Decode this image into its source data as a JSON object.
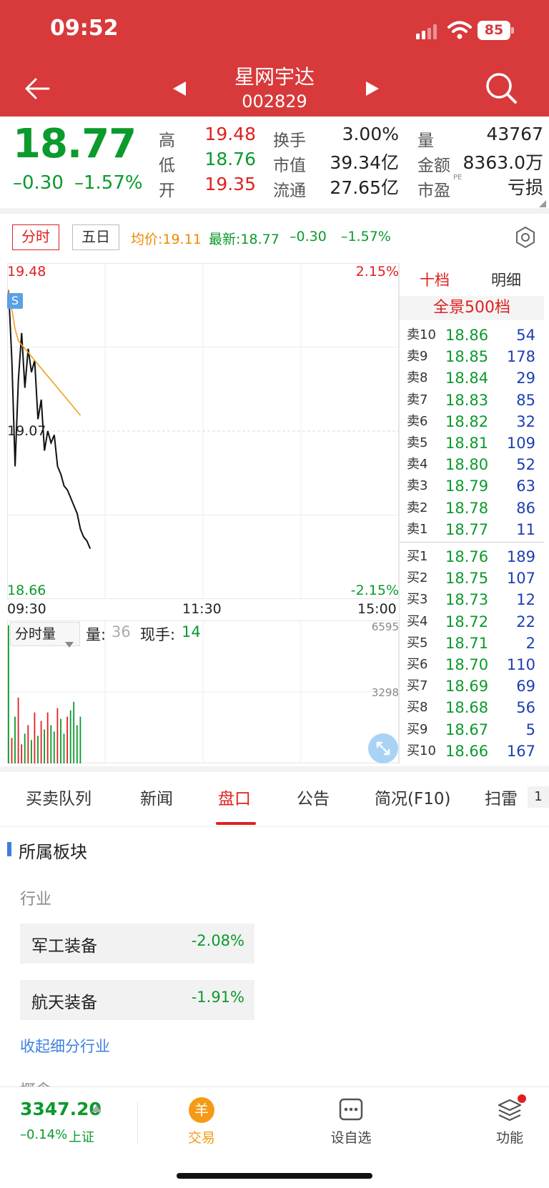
{
  "status_bar": {
    "time": "09:52",
    "battery": "85"
  },
  "header": {
    "name": "星网宇达",
    "code": "002829"
  },
  "quote": {
    "price": "18.77",
    "change": "–0.30",
    "change_pct": "–1.57%",
    "cells": [
      {
        "label": "高",
        "value": "19.48",
        "value_color": "red"
      },
      {
        "label": "换手",
        "value": "3.00%",
        "value_color": "dark"
      },
      {
        "label": "量",
        "value": "43767",
        "value_color": "dark"
      },
      {
        "label": "低",
        "value": "18.76",
        "value_color": "green"
      },
      {
        "label": "市值",
        "value": "39.34亿",
        "value_color": "dark"
      },
      {
        "label": "金额",
        "value": "8363.0万",
        "value_color": "dark"
      },
      {
        "label": "开",
        "value": "19.35",
        "value_color": "red"
      },
      {
        "label": "流通",
        "value": "27.65亿",
        "value_color": "dark"
      },
      {
        "label": "市盈",
        "value": "亏损",
        "value_color": "dark",
        "sup": "PE"
      }
    ]
  },
  "chart_tabs": {
    "intraday": "分时",
    "five_day": "五日",
    "avg_label": "均价:19.11",
    "latest_label": "最新:18.77",
    "latest_change": "–0.30",
    "latest_pct": "–1.57%"
  },
  "chart_data": {
    "type": "line",
    "ylim": [
      18.66,
      19.48
    ],
    "y_labels": {
      "top": "19.48",
      "mid": "19.07",
      "bottom": "18.66",
      "top_pct": "2.15%",
      "bottom_pct": "-2.15%"
    },
    "x_labels": [
      "09:30",
      "11:30",
      "15:00"
    ],
    "marker": "S",
    "series": [
      {
        "color": "#111111",
        "values": [
          19.43,
          19.25,
          18.98,
          19.2,
          19.32,
          19.18,
          19.28,
          19.22,
          19.25,
          19.1,
          19.15,
          19.02,
          19.07,
          19.04,
          19.06,
          18.98,
          18.96,
          18.93,
          18.92,
          18.9,
          18.88,
          18.86,
          18.82,
          18.8,
          18.79,
          18.77
        ]
      },
      {
        "color": "#f0a020",
        "values": [
          19.43,
          19.38,
          19.33,
          19.3,
          19.29,
          19.28,
          19.27,
          19.26,
          19.25,
          19.24,
          19.23,
          19.22,
          19.21,
          19.2,
          19.19,
          19.18,
          19.17,
          19.16,
          19.15,
          19.14,
          19.13,
          19.12,
          19.11
        ]
      }
    ],
    "volume": {
      "ylim": [
        0,
        6595
      ],
      "y_labels": {
        "top": "6595",
        "mid": "3298"
      },
      "values": [
        6500,
        1200,
        2200,
        3100,
        900,
        1400,
        1800,
        1100,
        2400,
        1300,
        2000,
        1600,
        2400,
        1800,
        1500,
        2600,
        2100,
        1400,
        2200,
        2500,
        2900,
        1800,
        2200
      ],
      "colors": [
        "g",
        "r",
        "g",
        "r",
        "r",
        "g",
        "r",
        "g",
        "r",
        "g",
        "r",
        "g",
        "r",
        "g",
        "g",
        "r",
        "g",
        "g",
        "r",
        "g",
        "g",
        "g",
        "g"
      ]
    }
  },
  "volume_panel": {
    "selector": "分时量",
    "vol_label": "量:",
    "vol_value": "36",
    "hand_label": "现手:",
    "hand_value": "14"
  },
  "orderbook": {
    "tab_active": "十档",
    "tab_detail": "明细",
    "panorama": "全景500档",
    "asks": [
      {
        "label": "卖10",
        "price": "18.86",
        "vol": "54"
      },
      {
        "label": "卖9",
        "price": "18.85",
        "vol": "178"
      },
      {
        "label": "卖8",
        "price": "18.84",
        "vol": "29"
      },
      {
        "label": "卖7",
        "price": "18.83",
        "vol": "85"
      },
      {
        "label": "卖6",
        "price": "18.82",
        "vol": "32"
      },
      {
        "label": "卖5",
        "price": "18.81",
        "vol": "109"
      },
      {
        "label": "卖4",
        "price": "18.80",
        "vol": "52"
      },
      {
        "label": "卖3",
        "price": "18.79",
        "vol": "63"
      },
      {
        "label": "卖2",
        "price": "18.78",
        "vol": "86"
      },
      {
        "label": "卖1",
        "price": "18.77",
        "vol": "11"
      }
    ],
    "bids": [
      {
        "label": "买1",
        "price": "18.76",
        "vol": "189"
      },
      {
        "label": "买2",
        "price": "18.75",
        "vol": "107"
      },
      {
        "label": "买3",
        "price": "18.73",
        "vol": "12"
      },
      {
        "label": "买4",
        "price": "18.72",
        "vol": "22"
      },
      {
        "label": "买5",
        "price": "18.71",
        "vol": "2"
      },
      {
        "label": "买6",
        "price": "18.70",
        "vol": "110"
      },
      {
        "label": "买7",
        "price": "18.69",
        "vol": "69"
      },
      {
        "label": "买8",
        "price": "18.68",
        "vol": "56"
      },
      {
        "label": "买9",
        "price": "18.67",
        "vol": "5"
      },
      {
        "label": "买10",
        "price": "18.66",
        "vol": "167"
      }
    ]
  },
  "tabs": [
    "买卖队列",
    "新闻",
    "盘口",
    "公告",
    "简况(F10)",
    "扫雷",
    "1"
  ],
  "sections": {
    "board_title": "所属板块",
    "industry_label": "行业",
    "sectors": [
      {
        "name": "军工装备",
        "pct": "-2.08%"
      },
      {
        "name": "航天装备",
        "pct": "-1.91%"
      }
    ],
    "collapse_link": "收起细分行业",
    "next_partial": "概念"
  },
  "bottom_bar": {
    "index_value": "3347.20",
    "index_change": "–0.14%",
    "index_name": "上证",
    "trade_icon": "羊",
    "trade_label": "交易",
    "watchlist_label": "设自选",
    "func_label": "功能"
  },
  "colors": {
    "header": "#d8393b",
    "up": "#e02020",
    "down": "#0b9a2c",
    "accent": "#e02020"
  }
}
